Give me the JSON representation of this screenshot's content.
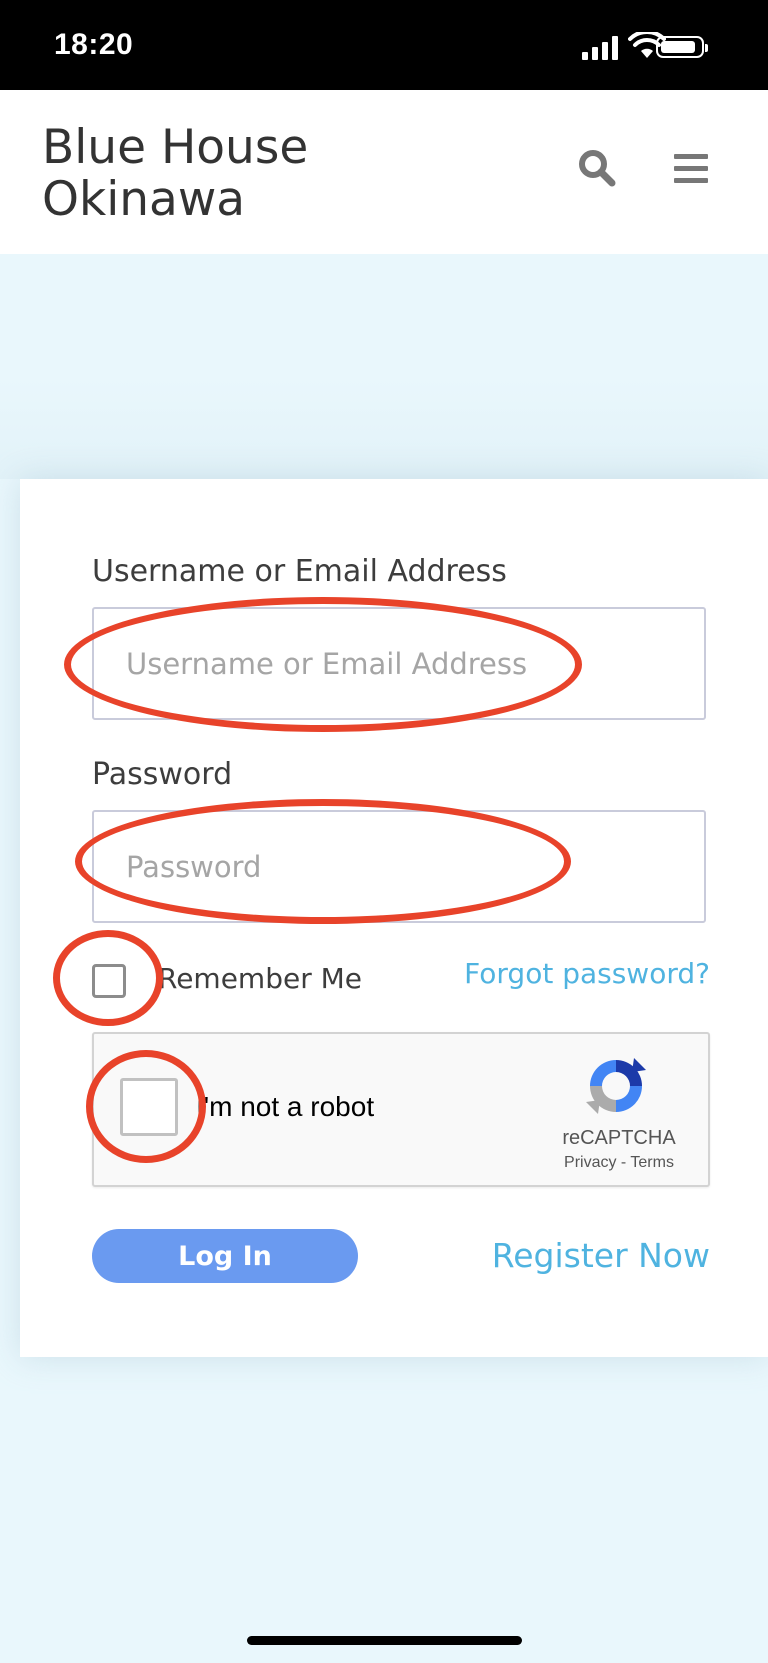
{
  "status_bar": {
    "time": "18:20",
    "icons": [
      "signal-icon",
      "wifi-icon",
      "battery-icon"
    ]
  },
  "header": {
    "site_title_line1": "Blue House",
    "site_title_line2": "Okinawa",
    "search_icon": "search-icon",
    "menu_icon": "hamburger-menu-icon"
  },
  "login_form": {
    "username_label": "Username or Email Address",
    "username_placeholder": "Username or Email Address",
    "username_value": "",
    "password_label": "Password",
    "password_placeholder": "Password",
    "password_value": "",
    "remember_label": "Remember Me",
    "remember_checked": false,
    "forgot_link": "Forgot password?",
    "login_button": "Log In",
    "register_link": "Register Now"
  },
  "recaptcha": {
    "checkbox_label": "I'm not a robot",
    "brand": "reCAPTCHA",
    "privacy": "Privacy",
    "separator": "-",
    "terms": "Terms"
  },
  "colors": {
    "annotation": "#e8432a",
    "link": "#4fb3e0",
    "button": "#6a9af0",
    "background": "#e9f7fc"
  }
}
